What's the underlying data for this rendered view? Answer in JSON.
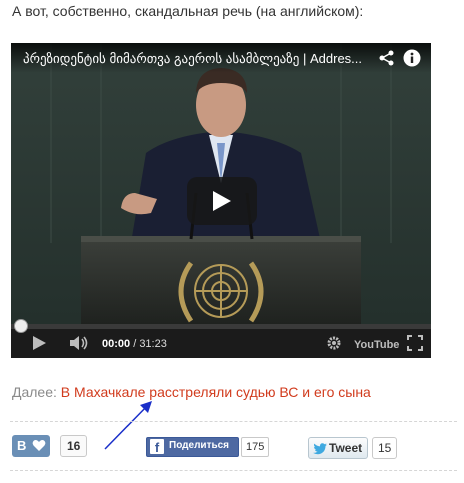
{
  "intro_text": "А вот, собственно, скандальная речь (на английском):",
  "video": {
    "title": "პრეზიდენტის მიმართვა გაეროს ასამბლეაზე | Addres...",
    "current_time": "00:00",
    "duration": "/ 31:23",
    "played_fraction": 0,
    "logo_text": "YouTube",
    "icons": [
      "share-icon",
      "info-icon",
      "play-icon",
      "volume-icon",
      "settings-icon",
      "fullscreen-icon"
    ]
  },
  "next_article": {
    "label": "Далее:",
    "link_text": "В Махачкале расстреляли судью ВС и его сына"
  },
  "social": {
    "vk": {
      "letter": "В",
      "count": "16"
    },
    "facebook": {
      "letter": "f",
      "label": "Поделиться",
      "count": "175"
    },
    "twitter": {
      "label": "Tweet",
      "count": "15"
    }
  },
  "colors": {
    "link": "#d13b1d",
    "vk": "#6a8fb6",
    "facebook": "#4e69a2",
    "arrow": "#1a2fc9"
  }
}
